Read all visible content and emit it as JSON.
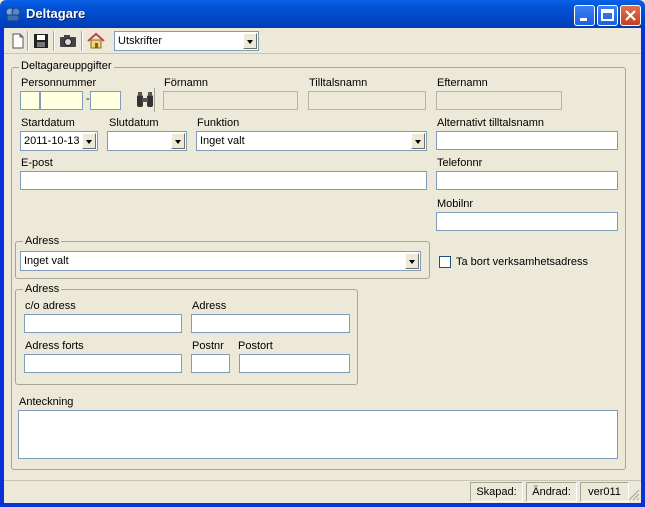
{
  "window": {
    "title": "Deltagare"
  },
  "toolbar": {
    "report_combo": "Utskrifter"
  },
  "participant": {
    "group_label": "Deltagareuppgifter",
    "personnummer_label": "Personnummer",
    "personnummer_separator": "-",
    "fornamn_label": "Förnamn",
    "tilltalsnamn_label": "Tilltalsnamn",
    "efternamn_label": "Efternamn",
    "startdatum_label": "Startdatum",
    "startdatum_value": "2011-10-13",
    "slutdatum_label": "Slutdatum",
    "slutdatum_value": "",
    "funktion_label": "Funktion",
    "funktion_value": "Inget valt",
    "alt_tilltalsnamn_label": "Alternativt tilltalsnamn",
    "epost_label": "E-post",
    "telefonnr_label": "Telefonnr",
    "mobilnr_label": "Mobilnr"
  },
  "adress_select": {
    "group_label": "Adress",
    "value": "Inget valt"
  },
  "remove_business_address": {
    "label": "Ta bort verksamhetsadress",
    "checked": false
  },
  "address": {
    "group_label": "Adress",
    "co_label": "c/o adress",
    "adress_label": "Adress",
    "adress_forts_label": "Adress forts",
    "postnr_label": "Postnr",
    "postort_label": "Postort"
  },
  "note": {
    "label": "Anteckning"
  },
  "status": {
    "skapad": "Skapad:",
    "andrad": "Ändrad:",
    "version": "ver011"
  }
}
